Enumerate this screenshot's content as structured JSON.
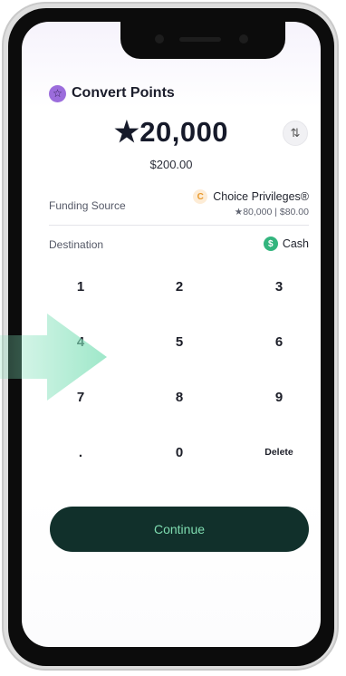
{
  "header": {
    "title": "Convert Points",
    "icon": "star-badge-icon"
  },
  "amount": {
    "value": "★20,000",
    "usd": "$200.00"
  },
  "funding_source": {
    "label": "Funding Source",
    "name": "Choice Privileges®",
    "balance": "★80,000 | $80.00"
  },
  "destination": {
    "label": "Destination",
    "value": "Cash",
    "icon_symbol": "$"
  },
  "keypad": {
    "k1": "1",
    "k2": "2",
    "k3": "3",
    "k4": "4",
    "k5": "5",
    "k6": "6",
    "k7": "7",
    "k8": "8",
    "k9": "9",
    "kdot": ".",
    "k0": "0",
    "kdel": "Delete"
  },
  "continue_label": "Continue",
  "colors": {
    "accent_purple": "#9b6cdc",
    "cash_green": "#33b57e",
    "button_bg": "#11302b",
    "button_text": "#7fdcb0",
    "overlay_arrow": "#7fe0b8"
  }
}
